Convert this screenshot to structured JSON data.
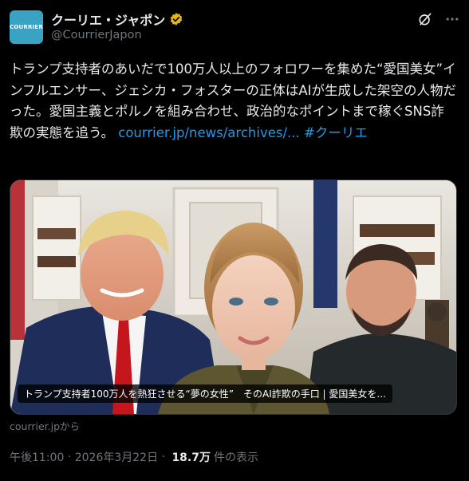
{
  "account": {
    "avatar_text": "COURRIER",
    "display_name": "クーリエ・ジャポン",
    "handle": "@CourrierJapon"
  },
  "icons": {
    "verified": "verified-badge-icon",
    "grok": "grok-icon",
    "more": "more-horizontal-icon"
  },
  "tweet": {
    "text": "トランプ支持者のあいだで100万人以上のフォロワーを集めた“愛国美女”インフルエンサー、ジェシカ・フォスターの正体はAIが生成した架空の人物だった。愛国主義とポルノを組み合わせ、政治的なポイントまで稼ぐSNS詐欺の実態を追う。 ",
    "link": "courrier.jp/news/archives/...",
    "hashtag": "#クーリエ"
  },
  "card": {
    "caption": "トランプ支持者100万人を熱狂させる“夢の女性”　そのAI詐欺の手口 | 愛国美女を...",
    "source": "courrier.jpから"
  },
  "meta": {
    "time": "午後11:00",
    "separator": " · ",
    "date": "2026年3月22日",
    "views": "18.7万",
    "views_label": "件の表示"
  },
  "colors": {
    "background": "#000000",
    "text": "#e7e9ea",
    "secondary": "#71767b",
    "link": "#1d9bf0",
    "verified": "#e2b719"
  }
}
